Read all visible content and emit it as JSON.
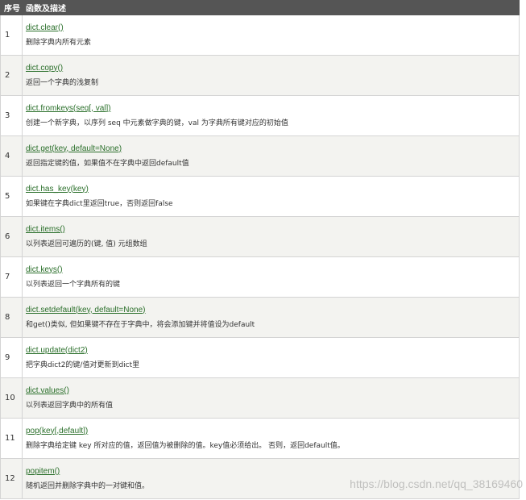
{
  "header": {
    "col1": "序号",
    "col2": "函数及描述"
  },
  "rows": [
    {
      "num": "1",
      "func": "dict.clear()",
      "desc": "删除字典内所有元素"
    },
    {
      "num": "2",
      "func": "dict.copy()",
      "desc": "返回一个字典的浅复制"
    },
    {
      "num": "3",
      "func": "dict.fromkeys(seq[, val])",
      "desc": "创建一个新字典，以序列 seq 中元素做字典的键，val 为字典所有键对应的初始值"
    },
    {
      "num": "4",
      "func": "dict.get(key, default=None)",
      "desc": "返回指定键的值，如果值不在字典中返回default值"
    },
    {
      "num": "5",
      "func": "dict.has_key(key)",
      "desc": "如果键在字典dict里返回true，否则返回false"
    },
    {
      "num": "6",
      "func": "dict.items()",
      "desc": "以列表返回可遍历的(键, 值) 元组数组"
    },
    {
      "num": "7",
      "func": "dict.keys()",
      "desc": "以列表返回一个字典所有的键"
    },
    {
      "num": "8",
      "func": "dict.setdefault(key, default=None)",
      "desc": "和get()类似, 但如果键不存在于字典中，将会添加键并将值设为default"
    },
    {
      "num": "9",
      "func": "dict.update(dict2)",
      "desc": "把字典dict2的键/值对更新到dict里"
    },
    {
      "num": "10",
      "func": "dict.values()",
      "desc": "以列表返回字典中的所有值"
    },
    {
      "num": "11",
      "func": "pop(key[,default])",
      "desc": "删除字典给定键 key 所对应的值，返回值为被删除的值。key值必须给出。 否则，返回default值。"
    },
    {
      "num": "12",
      "func": "popitem()",
      "desc": "随机返回并删除字典中的一对键和值。"
    }
  ],
  "watermark": "https://blog.csdn.net/qq_38169460"
}
